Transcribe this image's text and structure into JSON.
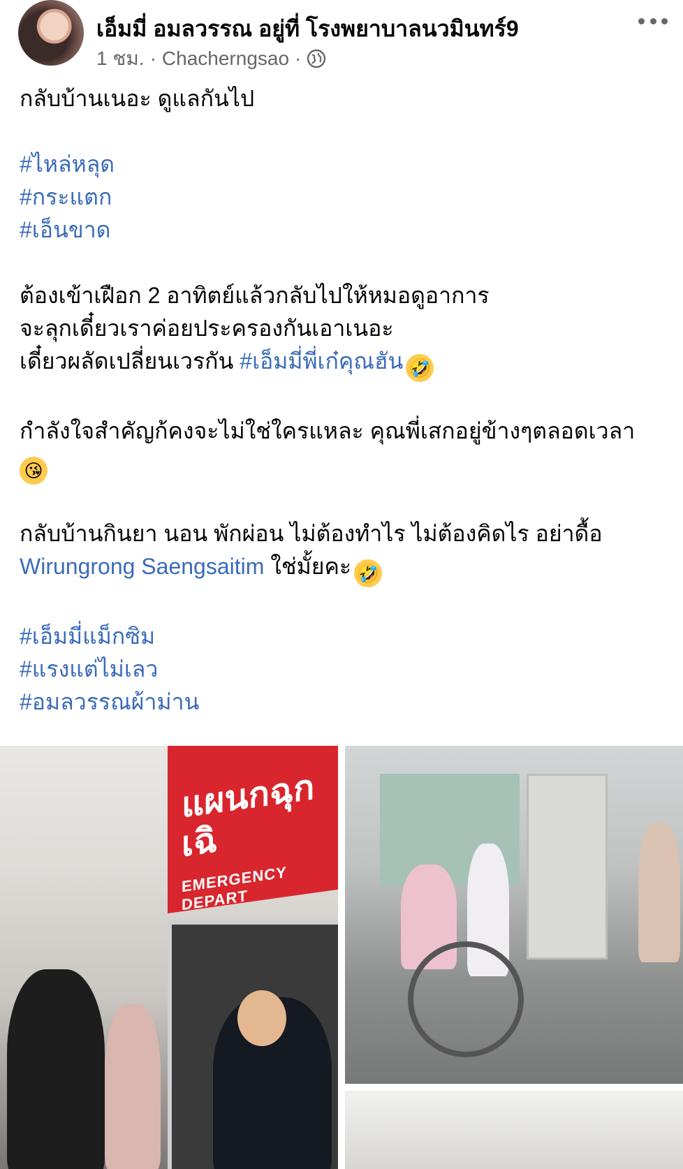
{
  "header": {
    "author": "เอ็มมี่ อมลวรรณ อยู่ที่ โรงพยาบาลนวมินทร์9",
    "time": "1 ชม.",
    "location": "Chacherngsao",
    "separator": "·",
    "privacy_icon": "globe-icon",
    "more_icon": "more-options-icon"
  },
  "post": {
    "line1": "กลับบ้านเนอะ ดูแลกันไป",
    "tags1": [
      "#ไหล่หลุด",
      "#กระแตก",
      "#เอ็นขาด"
    ],
    "para2_line1": "ต้องเข้าเฝือก 2 อาทิตย์แล้วกลับไปให้หมอดูอาการ",
    "para2_line2": "จะลุกเดี๋ยวเราค่อยประครองกันเอาเนอะ",
    "para2_line3_text": "เดี๋ยวผลัดเปลี่ยนเวรกัน ",
    "para2_line3_tag": "#เอ็มมี่พี่เก๋คุณฮัน",
    "para3_line1": "กำลังใจสำคัญก้คงจะไม่ใช่ใครแหละ คุณพี่เสกอยู่ข้างๆตลอดเวลา",
    "para4_line1": "กลับบ้านกินยา นอน พักผ่อน ไม่ต้องทำไร ไม่ต้องคิดไร อย่าดื้อ",
    "para4_mention": "Wirungrong Saengsaitim",
    "para4_tail": " ใช่มั้ยคะ",
    "tags2": [
      "#เอ็มมี่แม็กซิม",
      "#แรงแต่ไม่เลว",
      "#อมลวรรณผ้าม่าน"
    ],
    "emoji_laugh": "🤣",
    "emoji_kiss": "😘"
  },
  "photos": {
    "left_sign_thai": "แผนกฉุกเฉิ",
    "left_sign_en": "EMERGENCY DEPART"
  },
  "colors": {
    "link": "#3a6bb8",
    "meta": "#65676b",
    "sign": "#d9262e"
  }
}
